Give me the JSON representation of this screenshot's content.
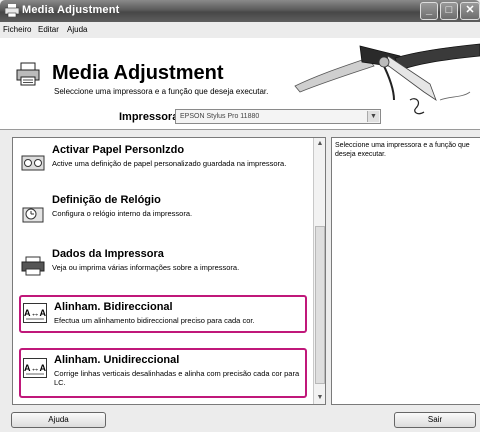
{
  "window": {
    "title": "Media Adjustment"
  },
  "menu": {
    "file": "Ficheiro",
    "edit": "Editar",
    "help": "Ajuda"
  },
  "header": {
    "title": "Media Adjustment",
    "subtitle": "Seleccione uma impressora e a função que deseja executar.",
    "printer_label": "Impressora",
    "printer_selected": "EPSON Stylus Pro 11880"
  },
  "items": [
    {
      "label": "Activar Papel Personlzdo",
      "desc": "Active uma definição de papel personalizado guardada na impressora.",
      "icon": "paper-roll-icon"
    },
    {
      "label": "Definição de Relógio",
      "desc": "Configura o relógio interno da impressora.",
      "icon": "clock-icon"
    },
    {
      "label": "Dados da Impressora",
      "desc": "Veja ou imprima várias informações sobre a impressora.",
      "icon": "printer-icon"
    },
    {
      "label": "Alinham. Bidireccional",
      "desc": "Efectua um alinhamento bidireccional preciso para cada cor.",
      "icon": "alignment-icon"
    },
    {
      "label": "Alinham. Unidireccional",
      "desc": "Corrige linhas verticais desalinhadas e alinha com precisão cada cor para LC.",
      "icon": "alignment-icon"
    }
  ],
  "info_text": "Seleccione uma impressora e a função que deseja executar.",
  "buttons": {
    "help": "Ajuda",
    "exit": "Sair"
  },
  "colors": {
    "highlight": "#c0187a",
    "titlebar": "#5a5a5a"
  }
}
